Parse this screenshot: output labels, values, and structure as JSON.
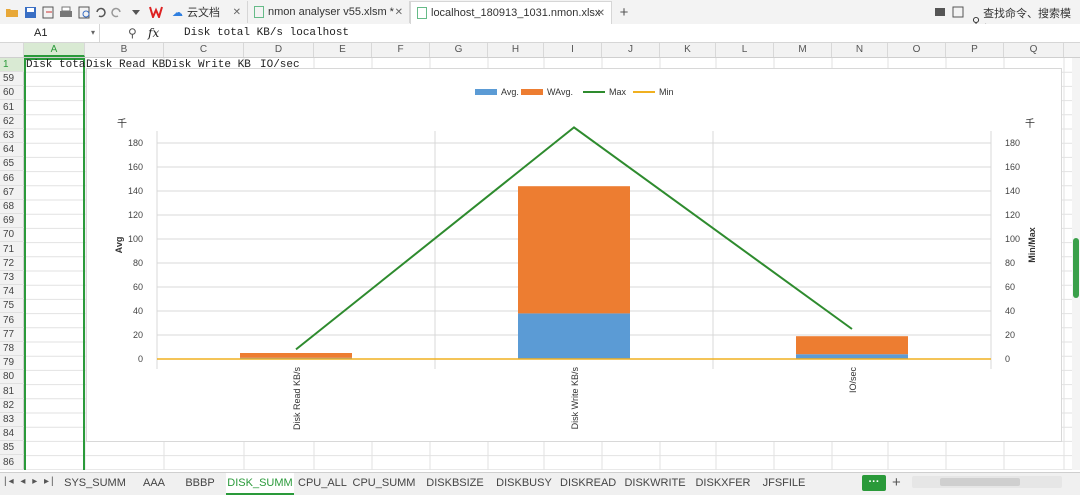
{
  "toolbar": {
    "tabs": [
      {
        "label": "云文档"
      },
      {
        "label": "nmon analyser v55.xlsm *"
      },
      {
        "label": "localhost_180913_1031.nmon.xlsx"
      }
    ],
    "search_label": "查找命令、搜索模板"
  },
  "formula_bar": {
    "cell_ref": "A1",
    "fx_label": "fx",
    "content": "Disk total KB/s localhost"
  },
  "columns": [
    "A",
    "B",
    "C",
    "D",
    "E",
    "F",
    "G",
    "H",
    "I",
    "J",
    "K",
    "L",
    "M",
    "N",
    "O",
    "P",
    "Q"
  ],
  "rows": [
    "1",
    "59",
    "60",
    "61",
    "62",
    "63",
    "64",
    "65",
    "66",
    "67",
    "68",
    "69",
    "70",
    "71",
    "72",
    "73",
    "74",
    "75",
    "76",
    "77",
    "78",
    "79",
    "80",
    "81",
    "82",
    "83",
    "84",
    "85",
    "86"
  ],
  "row1_cells": {
    "a": "Disk tota",
    "b": "Disk Read KB",
    "c": "Disk Write KB",
    "d": "IO/sec"
  },
  "sheet_tabs": [
    "SYS_SUMM",
    "AAA",
    "BBBP",
    "DISK_SUMM",
    "CPU_ALL",
    "CPU_SUMM",
    "DISKBSIZE",
    "DISKBUSY",
    "DISKREAD",
    "DISKWRITE",
    "DISKXFER",
    "JFSFILE"
  ],
  "active_sheet": "DISK_SUMM",
  "colors": {
    "avg": "#5b9bd5",
    "wavg": "#ed7d31",
    "max": "#2e8b2e",
    "min": "#f0b020",
    "accent": "#2a9a3a"
  },
  "chart_data": {
    "type": "bar",
    "categories": [
      "Disk Read KB/s",
      "Disk Write KB/s",
      "IO/sec"
    ],
    "series": [
      {
        "name": "Avg.",
        "type": "stacked-bar",
        "axis": "left",
        "values": [
          1,
          38,
          4
        ]
      },
      {
        "name": "WAvg.",
        "type": "stacked-bar",
        "axis": "left",
        "values": [
          4,
          106,
          15
        ]
      },
      {
        "name": "Max",
        "type": "line",
        "axis": "right",
        "values": [
          8,
          193,
          25
        ]
      },
      {
        "name": "Min",
        "type": "line",
        "axis": "right",
        "values": [
          0,
          0,
          0
        ]
      }
    ],
    "ylabel": "Avg",
    "y2label": "Min/Max",
    "yunit": "千",
    "ylim": [
      0,
      190
    ],
    "yticks": [
      0,
      20,
      40,
      60,
      80,
      100,
      120,
      140,
      160,
      180
    ],
    "grid": true,
    "legend": "top"
  }
}
